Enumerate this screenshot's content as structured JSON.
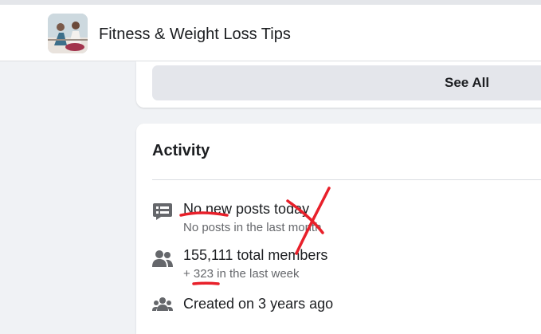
{
  "header": {
    "group_name": "Fitness & Weight Loss Tips"
  },
  "top_card": {
    "see_all_label": "See All"
  },
  "activity": {
    "title": "Activity",
    "rows": [
      {
        "icon": "chat-bubble-icon",
        "main": "No new posts today",
        "sub": "No posts in the last month"
      },
      {
        "icon": "members-icon",
        "main": "155,111 total members",
        "sub": "+ 323 in the last week"
      },
      {
        "icon": "group-icon",
        "main": "Created on 3 years ago",
        "sub": ""
      }
    ]
  },
  "colors": {
    "annotation_red": "#e8202a",
    "icon_gray": "#65676b",
    "button_bg": "#e4e6eb"
  }
}
